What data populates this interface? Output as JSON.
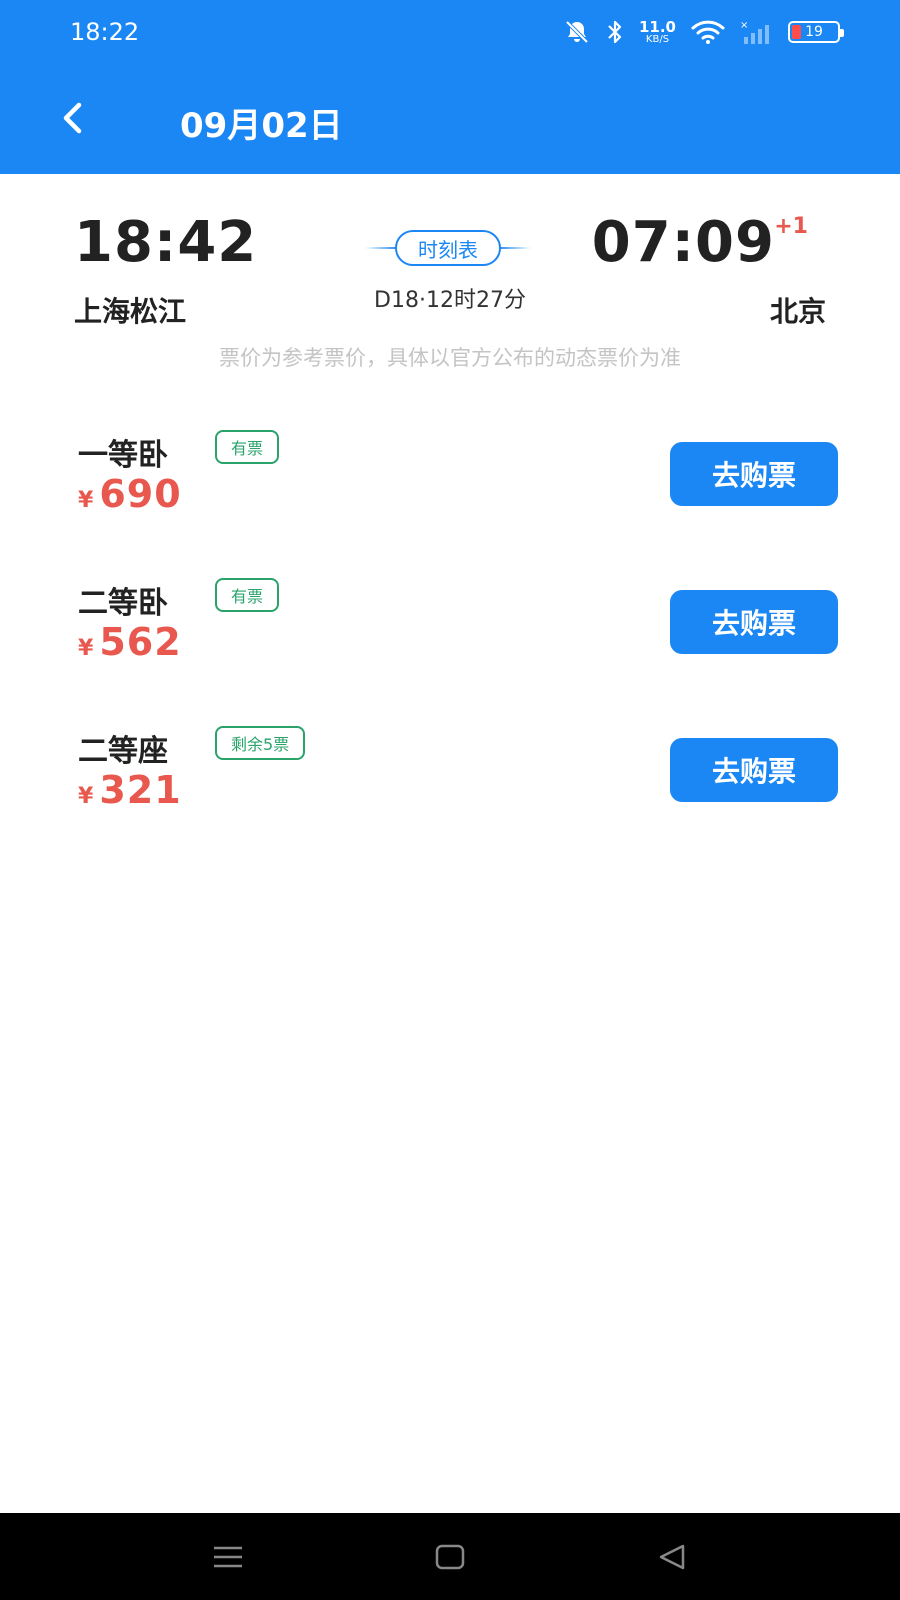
{
  "status_bar": {
    "time": "18:22",
    "net_speed_value": "11.0",
    "net_speed_unit": "KB/S",
    "battery_level": "19",
    "icons": [
      "mute-icon",
      "bluetooth-icon",
      "wifi-icon",
      "signal-icon",
      "battery-icon"
    ],
    "battery_color": "#ff4d4d"
  },
  "nav": {
    "title": "09月02日",
    "back_icon": "chevron-left-icon"
  },
  "journey": {
    "departure_time": "18:42",
    "departure_station": "上海松江",
    "arrival_time": "07:09",
    "arrival_day_offset": "+1",
    "arrival_station": "北京",
    "timetable_label": "时刻表",
    "train_info": "D18·12时27分",
    "price_note": "票价为参考票价，具体以官方公布的动态票价为准"
  },
  "seats": [
    {
      "name": "一等卧",
      "availability": "有票",
      "currency": "¥",
      "price": "690",
      "buy_label": "去购票"
    },
    {
      "name": "二等卧",
      "availability": "有票",
      "currency": "¥",
      "price": "562",
      "buy_label": "去购票"
    },
    {
      "name": "二等座",
      "availability": "剩余5票",
      "currency": "¥",
      "price": "321",
      "buy_label": "去购票"
    }
  ],
  "colors": {
    "primary": "#1b87f5",
    "price": "#e8584f",
    "badge": "#2aa36b",
    "note": "#c4c4c4"
  },
  "system_nav": {
    "icons": [
      "menu-icon",
      "home-icon",
      "back-triangle-icon"
    ]
  }
}
